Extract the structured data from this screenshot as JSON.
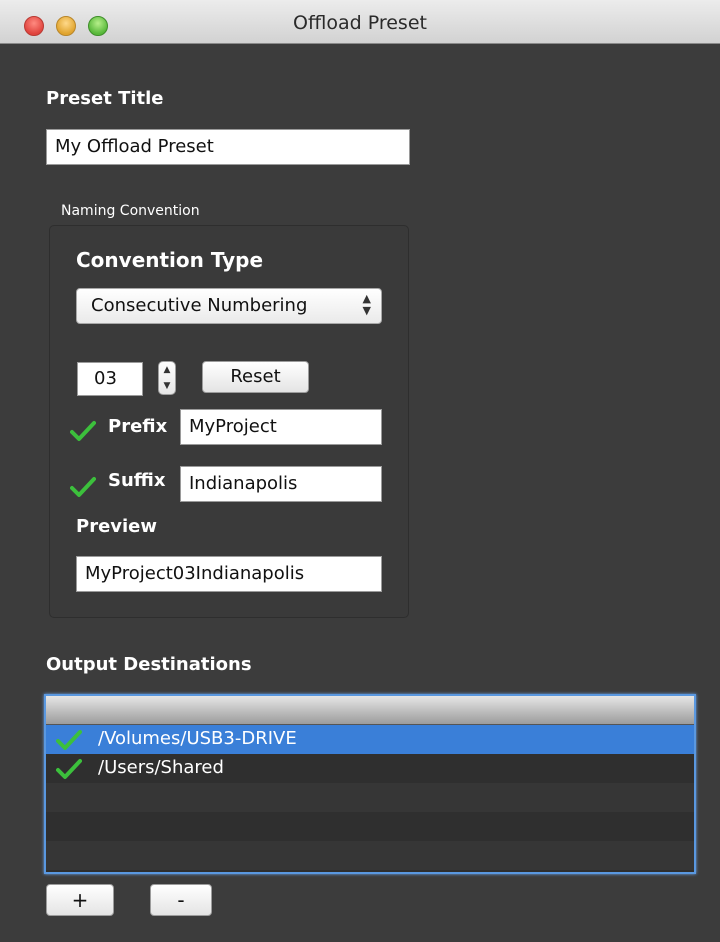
{
  "window": {
    "title": "Offload Preset"
  },
  "preset": {
    "title_label": "Preset Title",
    "title_value": "My Offload Preset"
  },
  "naming": {
    "group_label": "Naming Convention",
    "convention_type_label": "Convention Type",
    "convention_type_value": "Consecutive Numbering",
    "counter_value": "03",
    "reset_label": "Reset",
    "prefix": {
      "enabled": true,
      "label": "Prefix",
      "value": "MyProject"
    },
    "suffix": {
      "enabled": true,
      "label": "Suffix",
      "value": "Indianapolis"
    },
    "preview_label": "Preview",
    "preview_value": "MyProject03Indianapolis"
  },
  "outputs": {
    "label": "Output Destinations",
    "items": [
      {
        "path": "/Volumes/USB3-DRIVE",
        "checked": true,
        "selected": true
      },
      {
        "path": "/Users/Shared",
        "checked": true,
        "selected": false
      }
    ],
    "add_label": "+",
    "remove_label": "-"
  },
  "colors": {
    "background": "#3c3c3c",
    "selection": "#3a7fd8",
    "focus_ring": "#5a98e0",
    "checkmark": "#3cc03c"
  }
}
